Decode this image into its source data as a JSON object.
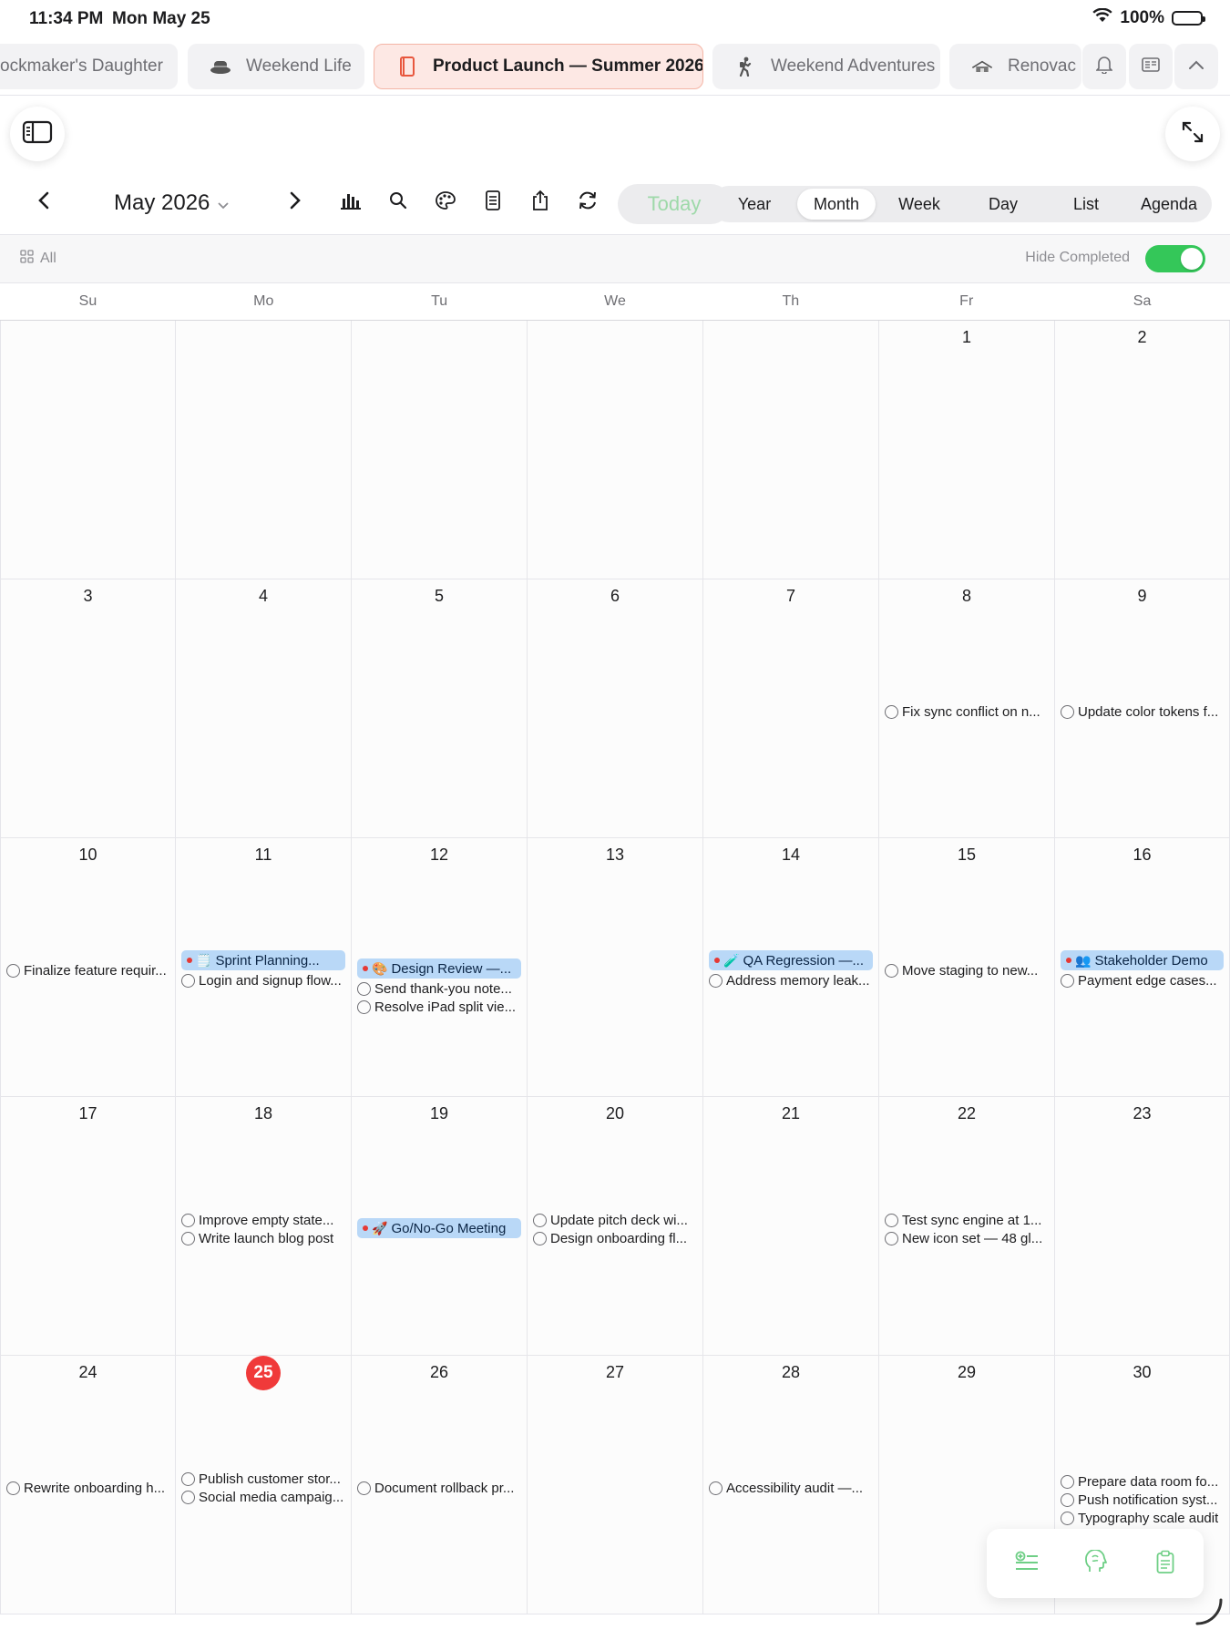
{
  "status": {
    "time": "11:34 PM",
    "date": "Mon May 25",
    "battery": "100%"
  },
  "tabs": [
    {
      "label": "ockmaker's Daughter",
      "icon": "none"
    },
    {
      "label": "Weekend Life",
      "icon": "hat-icon"
    },
    {
      "label": "Product Launch — Summer 2026",
      "icon": "book-icon",
      "active": true
    },
    {
      "label": "Weekend Adventures",
      "icon": "hiker-icon"
    },
    {
      "label": "Renovac",
      "icon": "house-icon"
    }
  ],
  "toolbar": {
    "month_title": "May 2026",
    "today_label": "Today",
    "views": [
      "Year",
      "Month",
      "Week",
      "Day",
      "List",
      "Agenda"
    ],
    "active_view": "Month"
  },
  "filter": {
    "all_label": "All",
    "hide_completed_label": "Hide Completed",
    "hide_completed_on": true
  },
  "weekdays": [
    "Su",
    "Mo",
    "Tu",
    "We",
    "Th",
    "Fr",
    "Sa"
  ],
  "colors": {
    "accent": "#34c759",
    "today_marker": "#f03a3a",
    "event_bg": "#b9d8f7",
    "active_tab_bg": "#fde8e4"
  },
  "days": [
    {
      "n": "",
      "col": 0,
      "row": 0,
      "events": [],
      "tasks": []
    },
    {
      "n": "",
      "col": 1,
      "row": 0,
      "events": [],
      "tasks": []
    },
    {
      "n": "",
      "col": 2,
      "row": 0,
      "events": [],
      "tasks": []
    },
    {
      "n": "",
      "col": 3,
      "row": 0,
      "events": [],
      "tasks": []
    },
    {
      "n": "",
      "col": 4,
      "row": 0,
      "events": [],
      "tasks": []
    },
    {
      "n": "1",
      "col": 5,
      "row": 0,
      "events": [],
      "tasks": []
    },
    {
      "n": "2",
      "col": 6,
      "row": 0,
      "events": [],
      "tasks": []
    },
    {
      "n": "3",
      "col": 0,
      "row": 1,
      "events": [],
      "tasks": []
    },
    {
      "n": "4",
      "col": 1,
      "row": 1,
      "events": [],
      "tasks": []
    },
    {
      "n": "5",
      "col": 2,
      "row": 1,
      "events": [],
      "tasks": []
    },
    {
      "n": "6",
      "col": 3,
      "row": 1,
      "events": [],
      "tasks": []
    },
    {
      "n": "7",
      "col": 4,
      "row": 1,
      "events": [],
      "tasks": []
    },
    {
      "n": "8",
      "col": 5,
      "row": 1,
      "events": [],
      "tasks": [
        "Fix sync conflict on n..."
      ]
    },
    {
      "n": "9",
      "col": 6,
      "row": 1,
      "events": [],
      "tasks": [
        "Update color tokens f..."
      ]
    },
    {
      "n": "10",
      "col": 0,
      "row": 2,
      "events": [],
      "tasks": [
        "Finalize feature requir..."
      ]
    },
    {
      "n": "11",
      "col": 1,
      "row": 2,
      "events": [
        {
          "emoji": "🗒️",
          "title": "Sprint Planning..."
        }
      ],
      "tasks": [
        "Login and signup flow..."
      ]
    },
    {
      "n": "12",
      "col": 2,
      "row": 2,
      "events": [
        {
          "emoji": "🎨",
          "title": "Design Review —..."
        }
      ],
      "tasks": [
        "Send thank-you note...",
        "Resolve iPad split vie..."
      ]
    },
    {
      "n": "13",
      "col": 3,
      "row": 2,
      "events": [],
      "tasks": []
    },
    {
      "n": "14",
      "col": 4,
      "row": 2,
      "events": [
        {
          "emoji": "🧪",
          "title": "QA Regression —..."
        }
      ],
      "tasks": [
        "Address memory leak..."
      ]
    },
    {
      "n": "15",
      "col": 5,
      "row": 2,
      "events": [],
      "tasks": [
        "Move staging to new..."
      ]
    },
    {
      "n": "16",
      "col": 6,
      "row": 2,
      "events": [
        {
          "emoji": "👥",
          "title": "Stakeholder Demo"
        }
      ],
      "tasks": [
        "Payment edge cases..."
      ]
    },
    {
      "n": "17",
      "col": 0,
      "row": 3,
      "events": [],
      "tasks": []
    },
    {
      "n": "18",
      "col": 1,
      "row": 3,
      "events": [],
      "tasks": [
        "Improve empty state...",
        "Write launch blog post"
      ]
    },
    {
      "n": "19",
      "col": 2,
      "row": 3,
      "events": [
        {
          "emoji": "🚀",
          "title": "Go/No-Go Meeting"
        }
      ],
      "tasks": []
    },
    {
      "n": "20",
      "col": 3,
      "row": 3,
      "events": [],
      "tasks": [
        "Update pitch deck wi...",
        "Design onboarding fl..."
      ]
    },
    {
      "n": "21",
      "col": 4,
      "row": 3,
      "events": [],
      "tasks": []
    },
    {
      "n": "22",
      "col": 5,
      "row": 3,
      "events": [],
      "tasks": [
        "Test sync engine at 1...",
        "New icon set — 48 gl..."
      ]
    },
    {
      "n": "23",
      "col": 6,
      "row": 3,
      "events": [],
      "tasks": []
    },
    {
      "n": "24",
      "col": 0,
      "row": 4,
      "events": [],
      "tasks": [
        "Rewrite onboarding h..."
      ]
    },
    {
      "n": "25",
      "col": 1,
      "row": 4,
      "today": true,
      "events": [],
      "tasks": [
        "Publish customer stor...",
        "Social media campaig..."
      ]
    },
    {
      "n": "26",
      "col": 2,
      "row": 4,
      "events": [],
      "tasks": [
        "Document rollback pr..."
      ]
    },
    {
      "n": "27",
      "col": 3,
      "row": 4,
      "events": [],
      "tasks": []
    },
    {
      "n": "28",
      "col": 4,
      "row": 4,
      "events": [],
      "tasks": [
        "Accessibility audit —..."
      ]
    },
    {
      "n": "29",
      "col": 5,
      "row": 4,
      "events": [],
      "tasks": []
    },
    {
      "n": "30",
      "col": 6,
      "row": 4,
      "events": [],
      "tasks": [
        "Prepare data room fo...",
        "Push notification syst...",
        "Typography scale audit"
      ]
    }
  ]
}
